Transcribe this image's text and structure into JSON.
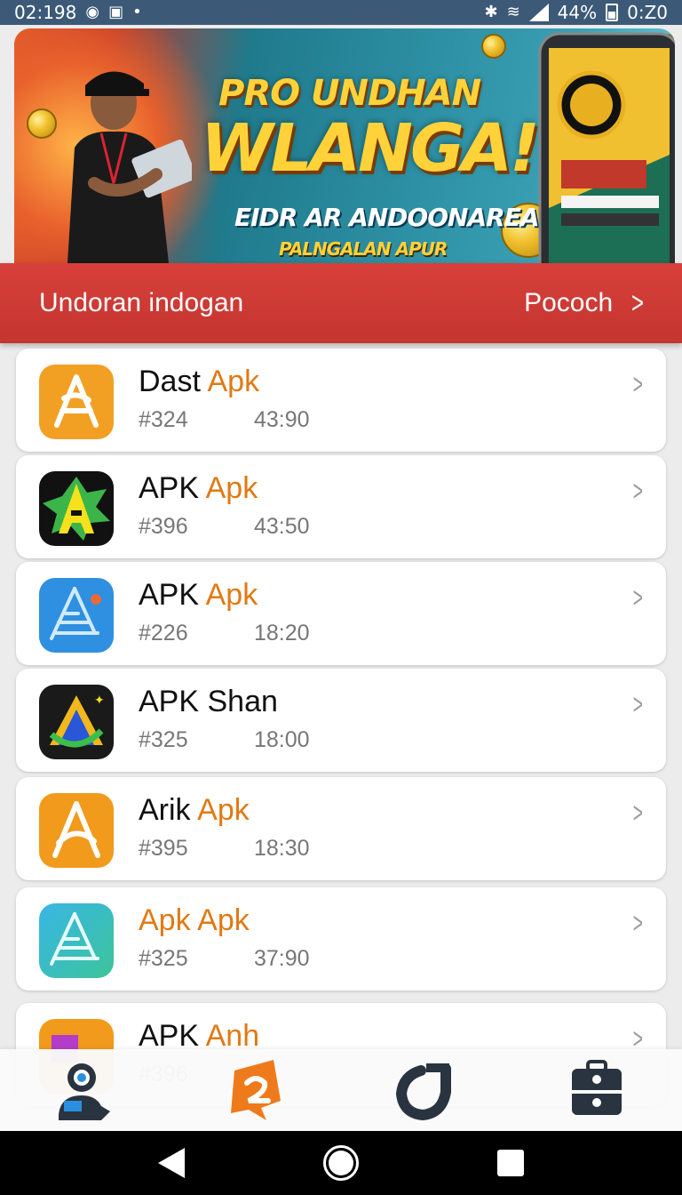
{
  "status_bar": {
    "time": "02:198",
    "battery": "44%",
    "clock_right": "0:Z0"
  },
  "banner": {
    "line1": "PRO UNDHAN",
    "line2": "WLANGA!",
    "line3": "EIDR AR ANDOONAREA",
    "line4": "PALNGALAN APUR"
  },
  "section": {
    "title": "Undoran indogan",
    "more_label": "Pococh"
  },
  "apps": [
    {
      "name": "Dast",
      "accent": "Apk",
      "id": "#324",
      "time": "43:90",
      "icon": "orange-a-icon"
    },
    {
      "name": "APK",
      "accent": "Apk",
      "id": "#396",
      "time": "43:50",
      "icon": "green-yellow-a-icon"
    },
    {
      "name": "APK",
      "accent": "Apk",
      "id": "#226",
      "time": "18:20",
      "icon": "blue-a-icon"
    },
    {
      "name": "APK Shan",
      "accent": "",
      "id": "#325",
      "time": "18:00",
      "icon": "dark-triangle-a-icon"
    },
    {
      "name": "Arik",
      "accent": "Apk",
      "id": "#395",
      "time": "18:30",
      "icon": "orange-a-icon"
    },
    {
      "name": "",
      "accent": "Apk Apk",
      "id": "#325",
      "time": "37:90",
      "icon": "teal-a-icon"
    },
    {
      "name": "APK",
      "accent": "Anh",
      "id": "#396",
      "time": "",
      "icon": "purple-orange-icon"
    }
  ],
  "bottom_nav": [
    {
      "icon": "profile-camera-icon"
    },
    {
      "icon": "apk-logo-icon"
    },
    {
      "icon": "refresh-icon"
    },
    {
      "icon": "briefcase-icon"
    }
  ],
  "colors": {
    "header_red": "#c43530",
    "accent_orange": "#e07a14",
    "status_bar": "#3c5a78"
  }
}
